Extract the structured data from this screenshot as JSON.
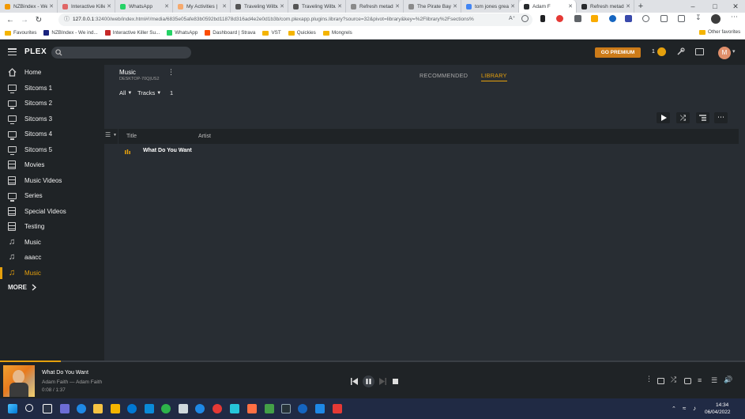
{
  "browser": {
    "tabs": [
      {
        "title": "NZBindex - We",
        "color": "#f29900"
      },
      {
        "title": "Interactive Kille",
        "color": "#e06666"
      },
      {
        "title": "WhatsApp",
        "color": "#25d366"
      },
      {
        "title": "My Activities |",
        "color": "#f6a96d"
      },
      {
        "title": "Traveling Wilbu",
        "color": "#555555"
      },
      {
        "title": "Traveling Wilbu",
        "color": "#555555"
      },
      {
        "title": "Refresh metadat",
        "color": "#8a8a8a"
      },
      {
        "title": "The Pirate Bay",
        "color": "#8a8a8a"
      },
      {
        "title": "tom jones great",
        "color": "#4285f4"
      },
      {
        "title": "Adam F",
        "color": "#282a2d"
      },
      {
        "title": "Refresh metadat",
        "color": "#282a2d"
      }
    ],
    "url_host": "127.0.0.1",
    "url_rest": ":32400/web/index.html#!/media/6835e05afe83b0592bd11878d316ad4e2e0d1b3b/com.plexapp.plugins.library?source=32&pivot=library&key=%2Flibrary%2Fsections%",
    "bookmarks": [
      {
        "label": "Favourites",
        "type": "folder"
      },
      {
        "label": "NZBIndex - We ind...",
        "type": "site",
        "color": "#1a237e"
      },
      {
        "label": "Interactive Killer Su...",
        "type": "site",
        "color": "#c62828"
      },
      {
        "label": "WhatsApp",
        "type": "site",
        "color": "#25d366"
      },
      {
        "label": "Dashboard | Strava",
        "type": "site",
        "color": "#fc4c02"
      },
      {
        "label": "VST",
        "type": "folder"
      },
      {
        "label": "Quickies",
        "type": "folder"
      },
      {
        "label": "Mongrels",
        "type": "folder"
      }
    ],
    "other_favorites": "Other favorites"
  },
  "plex": {
    "logo": "PLEX",
    "go_premium": "GO PREMIUM",
    "activity_count": "1",
    "user_initial": "M",
    "sidebar": [
      {
        "label": "Home",
        "icon": "home-icon",
        "type": "home"
      },
      {
        "label": "Sitcoms 1",
        "icon": "tv-icon",
        "type": "tv"
      },
      {
        "label": "Sitcoms 2",
        "icon": "tv-icon",
        "type": "tv"
      },
      {
        "label": "Sitcoms 3",
        "icon": "tv-icon",
        "type": "tv"
      },
      {
        "label": "Sitcoms 4",
        "icon": "tv-icon",
        "type": "tv"
      },
      {
        "label": "Sitcoms 5",
        "icon": "tv-icon",
        "type": "tv"
      },
      {
        "label": "Movies",
        "icon": "film-icon",
        "type": "film"
      },
      {
        "label": "Music Videos",
        "icon": "film-icon",
        "type": "film"
      },
      {
        "label": "Series",
        "icon": "tv-icon",
        "type": "tv"
      },
      {
        "label": "Special Videos",
        "icon": "film-icon",
        "type": "film"
      },
      {
        "label": "Testing",
        "icon": "film-icon",
        "type": "film"
      },
      {
        "label": "Music",
        "icon": "music-note-icon",
        "type": "music"
      },
      {
        "label": "aaacc",
        "icon": "music-note-icon",
        "type": "music"
      },
      {
        "label": "Music",
        "icon": "music-note-icon",
        "type": "music",
        "active": true
      }
    ],
    "sidebar_more": "MORE",
    "library": {
      "title": "Music",
      "server": "DESKTOP-70Q|US2",
      "tabs": {
        "recommended": "RECOMMENDED",
        "library": "LIBRARY"
      },
      "filter_all": "All",
      "filter_type": "Tracks",
      "count": "1",
      "columns": [
        "Title",
        "Artist"
      ],
      "rows": [
        {
          "title": "What Do You Want",
          "artist": ""
        }
      ]
    },
    "player": {
      "track": "What Do You Want",
      "subtitle": "Adam Faith — Adam Faith",
      "time": "0:08 / 1:37",
      "progress": 0.082
    }
  },
  "taskbar": {
    "time": "14:34",
    "date": "06/04/2022"
  },
  "colors": {
    "accent": "#e5a00d",
    "sidebar_bg": "#1f2326",
    "main_bg": "#282d33"
  }
}
